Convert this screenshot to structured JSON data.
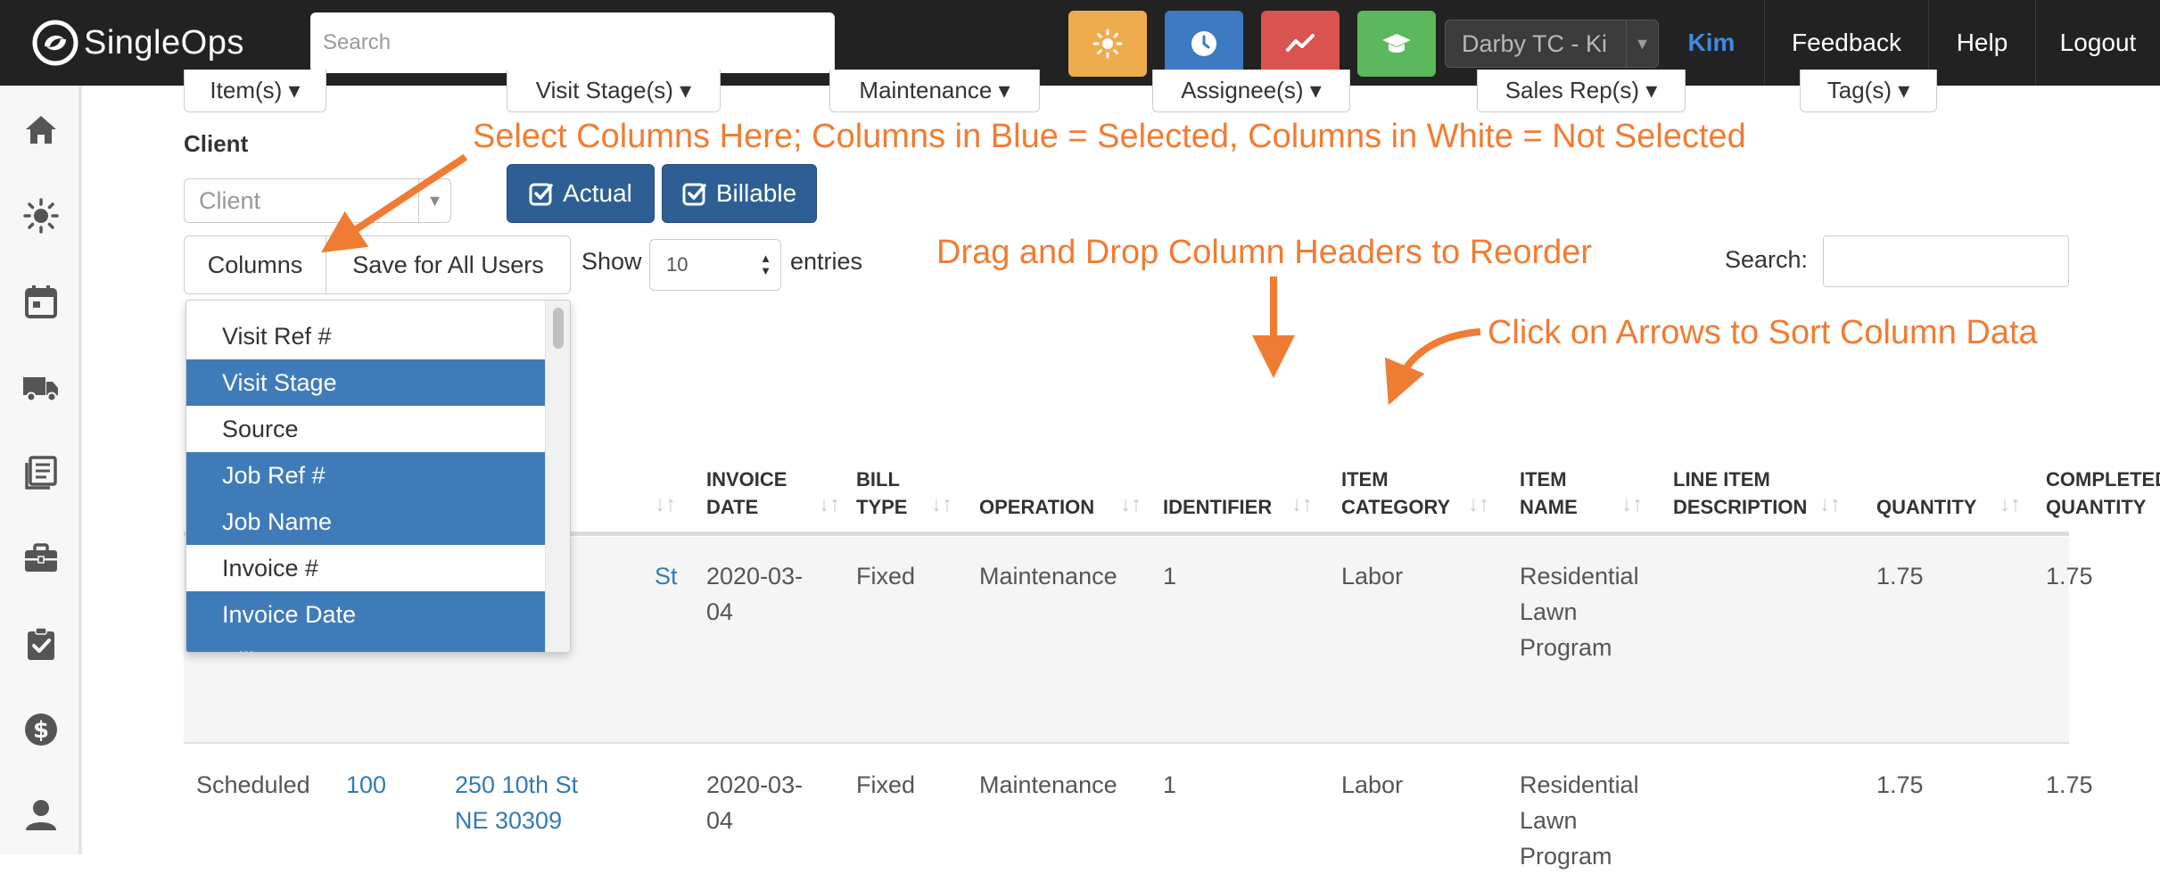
{
  "app": {
    "logo_text": "SingleOps",
    "search_placeholder": "Search",
    "account": "Darby TC - Ki",
    "nav": {
      "user": "Kim",
      "feedback": "Feedback",
      "help": "Help",
      "logout": "Logout"
    },
    "nav_colors": {
      "weather": "#efac4e",
      "clock": "#3e7ac2",
      "trend": "#d9534f",
      "learn": "#5cb85c"
    }
  },
  "sidebar": {
    "icons": [
      "home-icon",
      "sun-icon",
      "calendar-icon",
      "truck-icon",
      "book-icon",
      "briefcase-icon",
      "checklist-icon",
      "dollar-icon",
      "user-icon"
    ]
  },
  "filters": {
    "items": "Item(s)",
    "visit_stages": "Visit Stage(s)",
    "maintenance": "Maintenance",
    "assignees": "Assignee(s)",
    "sales_reps": "Sales Rep(s)",
    "tags": "Tag(s)"
  },
  "client": {
    "label": "Client",
    "placeholder": "Client"
  },
  "toggles": {
    "actual": "Actual",
    "billable": "Billable"
  },
  "controls": {
    "columns": "Columns",
    "save_all": "Save for All Users",
    "show": "Show",
    "entries_value": "10",
    "entries": "entries",
    "search": "Search:"
  },
  "columns_menu": {
    "items": [
      {
        "label": "Visit Ref #",
        "selected": false
      },
      {
        "label": "Visit Stage",
        "selected": true
      },
      {
        "label": "Source",
        "selected": false
      },
      {
        "label": "Job Ref #",
        "selected": true
      },
      {
        "label": "Job Name",
        "selected": true
      },
      {
        "label": "Invoice #",
        "selected": false
      },
      {
        "label": "Invoice Date",
        "selected": true
      },
      {
        "label": "Bill Type",
        "selected": true
      }
    ]
  },
  "table": {
    "headers": {
      "invoice_date_1": "INVOICE",
      "invoice_date_2": "DATE",
      "bill_type_1": "BILL",
      "bill_type_2": "TYPE",
      "operation": "OPERATION",
      "identifier": "IDENTIFIER",
      "item_category_1": "ITEM",
      "item_category_2": "CATEGORY",
      "item_name_1": "ITEM",
      "item_name_2": "NAME",
      "line_item_1": "LINE ITEM",
      "line_item_2": "DESCRIPTION",
      "quantity": "QUANTITY",
      "completed_1": "COMPLETED",
      "completed_2": "QUANTITY"
    },
    "row1": {
      "job_name_partial": "St",
      "invoice_date_1": "2020-03-",
      "invoice_date_2": "04",
      "bill_type": "Fixed",
      "operation": "Maintenance",
      "identifier": "1",
      "item_category": "Labor",
      "item_name_1": "Residential",
      "item_name_2": "Lawn",
      "item_name_3": "Program",
      "quantity": "1.75",
      "completed_quantity": "1.75"
    },
    "row2": {
      "visit_stage": "Scheduled",
      "job_ref": "100",
      "job_name_1": "250 10th St",
      "job_name_2": "NE 30309",
      "invoice_date_1": "2020-03-",
      "invoice_date_2": "04",
      "bill_type": "Fixed",
      "operation": "Maintenance",
      "identifier": "1",
      "item_category": "Labor",
      "item_name_1": "Residential",
      "item_name_2": "Lawn",
      "item_name_3": "Program",
      "quantity": "1.75",
      "completed_quantity": "1.75"
    }
  },
  "annotations": {
    "select_columns": "Select Columns Here; Columns in Blue = Selected, Columns in White = Not Selected",
    "drag_drop": "Drag and Drop Column Headers to Reorder",
    "sort": "Click on Arrows to Sort Column Data",
    "color": "#f07c33"
  }
}
